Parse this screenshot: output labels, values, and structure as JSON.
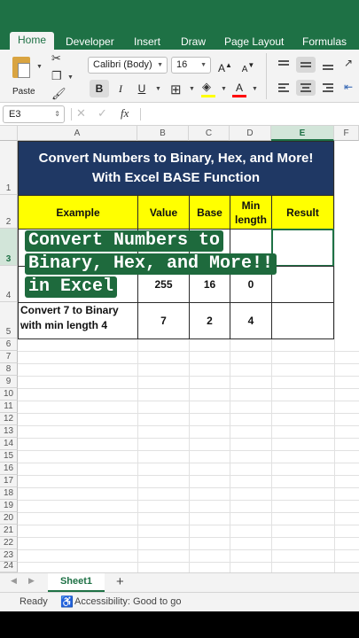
{
  "ribbon": {
    "tabs": [
      "Home",
      "Developer",
      "Insert",
      "Draw",
      "Page Layout",
      "Formulas"
    ],
    "active_tab": "Home",
    "paste_label": "Paste",
    "font_name": "Calibri (Body)",
    "font_size": "16",
    "bold": "B",
    "italic": "I",
    "underline": "U",
    "grow_font": "A",
    "shrink_font": "A",
    "font_color": "A"
  },
  "formula_bar": {
    "name_box": "E3",
    "cancel": "✕",
    "enter": "✓",
    "fx": "fx",
    "value": ""
  },
  "grid": {
    "columns": [
      "A",
      "B",
      "C",
      "D",
      "E",
      "F"
    ],
    "rows": [
      "1",
      "2",
      "3",
      "4",
      "5",
      "6",
      "7",
      "8",
      "9",
      "10",
      "11",
      "12",
      "13",
      "14",
      "15",
      "16",
      "17",
      "18",
      "19",
      "20",
      "21",
      "22",
      "23",
      "24"
    ]
  },
  "sheet": {
    "title_line1": "Convert Numbers to Binary, Hex, and More!",
    "title_line2": "With Excel BASE Function",
    "headers": [
      "Example",
      "Value",
      "Base",
      "Min length",
      "Result"
    ],
    "header_min_length_line1": "Min",
    "header_min_length_line2": "length",
    "row4": {
      "value": "255",
      "base": "16",
      "min_length": "0",
      "result": ""
    },
    "row5": {
      "example_line1": "Convert 7 to Binary",
      "example_line2": "with min length 4",
      "value": "7",
      "base": "2",
      "min_length": "4",
      "result": ""
    }
  },
  "overlay": {
    "line1": "Convert Numbers to",
    "line2": "Binary, Hex, and More!!",
    "line3": "in Excel",
    "color": "#1e6a3d"
  },
  "sheet_tabs": {
    "active": "Sheet1",
    "add": "+"
  },
  "status_bar": {
    "ready": "Ready",
    "accessibility": "Accessibility: Good to go"
  },
  "colors": {
    "brand": "#1e7145",
    "title_bg": "#1f3864",
    "header_bg": "#ffff00"
  }
}
